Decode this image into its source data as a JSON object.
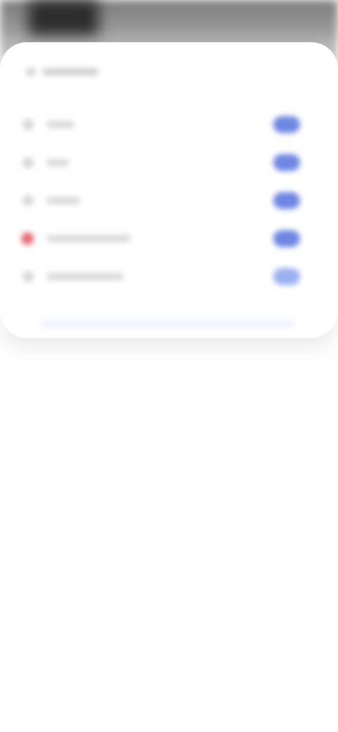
{
  "header": {
    "icon": "list-icon"
  },
  "rows": [
    {
      "icon": "circle-icon",
      "action_color": "#6f86e3"
    },
    {
      "icon": "circle-icon",
      "action_color": "#6f86e3"
    },
    {
      "icon": "circle-icon",
      "action_color": "#6f86e3"
    },
    {
      "icon": "alert-icon",
      "action_color": "#6f86e3"
    },
    {
      "icon": "circle-icon",
      "action_color": "#9ab0f0"
    }
  ],
  "colors": {
    "accent": "#6f86e3",
    "alert": "#e66b74",
    "backdrop_dark": "#2c2c2c"
  }
}
